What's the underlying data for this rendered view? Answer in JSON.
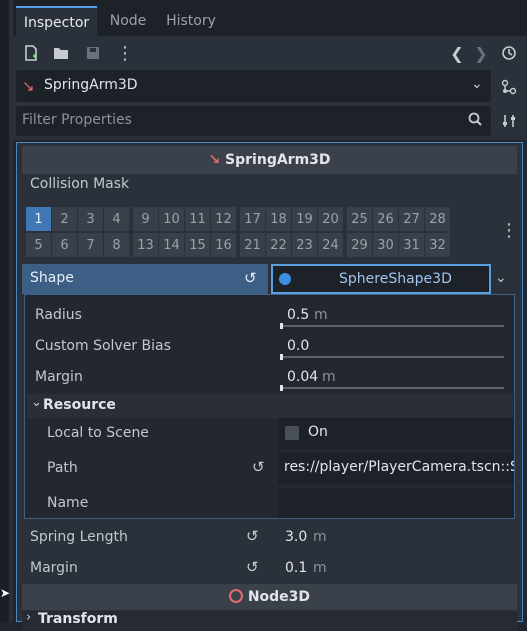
{
  "tabs": [
    {
      "label": "Inspector"
    },
    {
      "label": "Node"
    },
    {
      "label": "History"
    }
  ],
  "object_selector": {
    "label": "SpringArm3D"
  },
  "filter": {
    "placeholder": "Filter Properties"
  },
  "section_header": {
    "label": "SpringArm3D"
  },
  "collision_mask": {
    "label": "Collision Mask",
    "row1": [
      "1",
      "2",
      "3",
      "4",
      "9",
      "10",
      "11",
      "12",
      "17",
      "18",
      "19",
      "20",
      "25",
      "26",
      "27",
      "28"
    ],
    "row2": [
      "5",
      "6",
      "7",
      "8",
      "13",
      "14",
      "15",
      "16",
      "21",
      "22",
      "23",
      "24",
      "29",
      "30",
      "31",
      "32"
    ],
    "checked": [
      "1"
    ]
  },
  "shape": {
    "label": "Shape",
    "resource": "SphereShape3D",
    "radius": {
      "label": "Radius",
      "value": "0.5",
      "unit": "m"
    },
    "custom_solver_bias": {
      "label": "Custom Solver Bias",
      "value": "0.0"
    },
    "margin": {
      "label": "Margin",
      "value": "0.04",
      "unit": "m"
    },
    "resource_group": {
      "label": "Resource"
    },
    "local_to_scene": {
      "label": "Local to Scene",
      "value": "On"
    },
    "path": {
      "label": "Path",
      "value": "res://player/PlayerCamera.tscn::S"
    },
    "name": {
      "label": "Name",
      "value": ""
    }
  },
  "spring_length": {
    "label": "Spring Length",
    "value": "3.0",
    "unit": "m"
  },
  "margin": {
    "label": "Margin",
    "value": "0.1",
    "unit": "m"
  },
  "node3d_header": {
    "label": "Node3D"
  },
  "transform": {
    "label": "Transform"
  },
  "colors": {
    "accent": "#4b88c2",
    "mask_on": "#3f78b4",
    "springarm_icon": "#e36b6b",
    "sphere": "#3b8fe0"
  }
}
